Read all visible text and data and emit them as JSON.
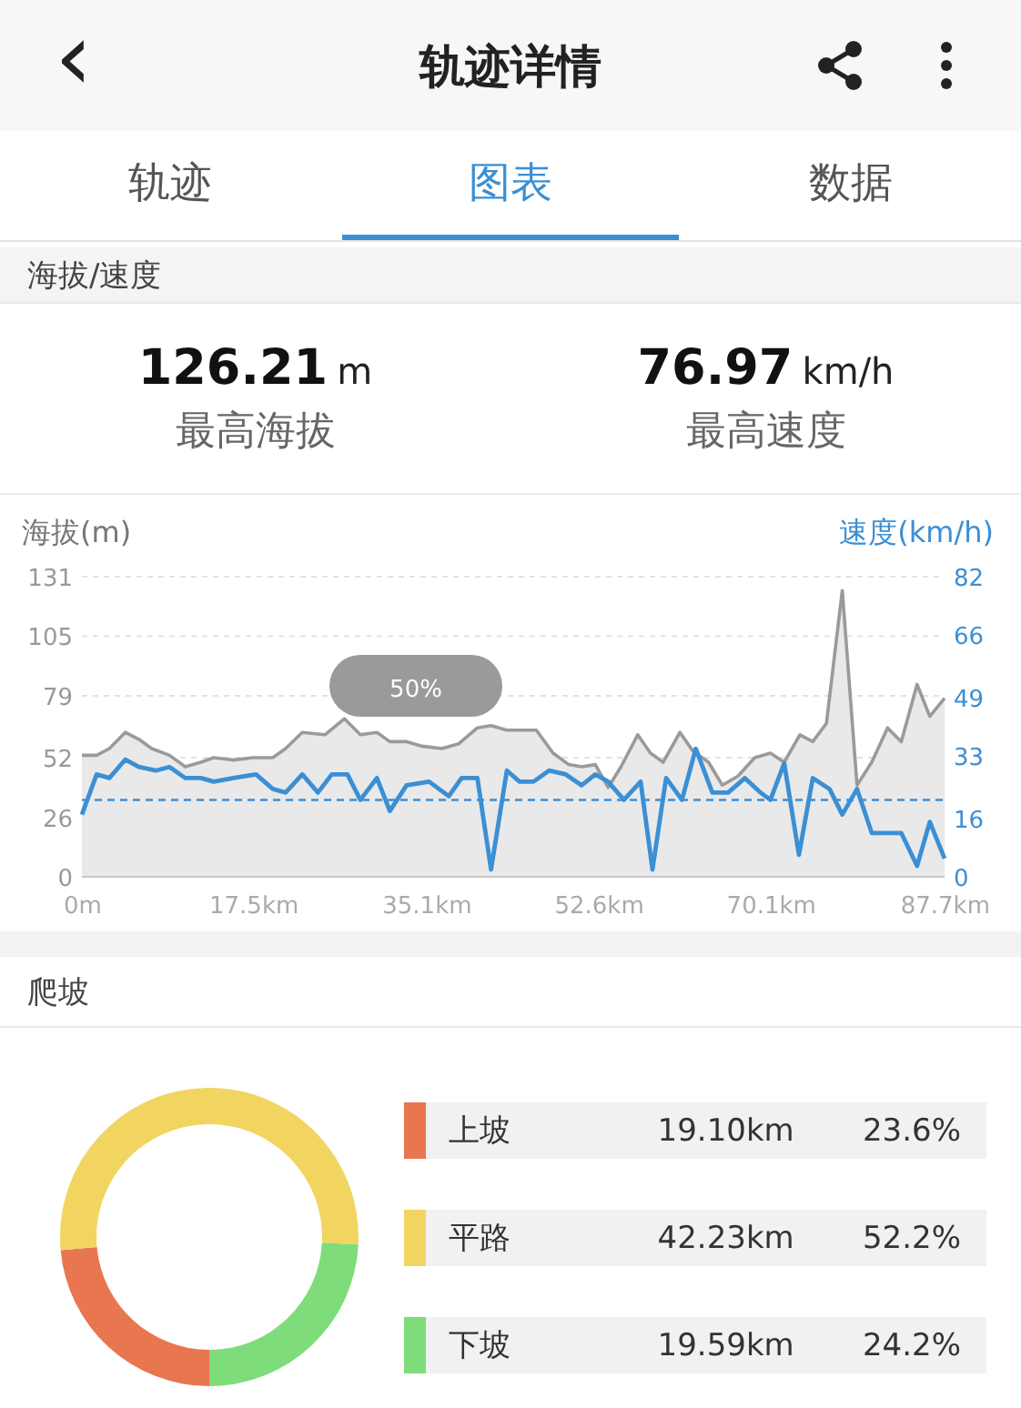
{
  "header": {
    "back": "‹",
    "title": "轨迹详情"
  },
  "tabs": [
    {
      "label": "轨迹",
      "selected": false
    },
    {
      "label": "图表",
      "selected": true
    },
    {
      "label": "数据",
      "selected": false
    }
  ],
  "altitude_speed": {
    "section_title": "海拔/速度",
    "stats": [
      {
        "value": "126.21",
        "unit": "m",
        "label": "最高海拔"
      },
      {
        "value": "76.97",
        "unit": "km/h",
        "label": "最高速度"
      }
    ],
    "zoom_badge": "50%",
    "chart_data": {
      "type": "line",
      "grid": true,
      "xlim": [
        0,
        87.7
      ],
      "ylim": [
        0,
        131
      ],
      "y2lim": [
        0,
        82
      ],
      "y2ticks": [
        0,
        16,
        33,
        49,
        66,
        82
      ],
      "ref_lines": [
        {
          "axis": "y2",
          "value": 21,
          "color": "#3b8fd4"
        }
      ],
      "xticks": [
        {
          "value": 0,
          "label": "0m"
        },
        {
          "value": 17.5,
          "label": "17.5km"
        },
        {
          "value": 35.1,
          "label": "35.1km"
        },
        {
          "value": 52.6,
          "label": "52.6km"
        },
        {
          "value": 70.1,
          "label": "70.1km"
        },
        {
          "value": 87.7,
          "label": "87.7km"
        }
      ],
      "yticks": [
        0,
        26,
        52,
        79,
        105,
        131
      ],
      "series": [
        {
          "name": "海拔(m)",
          "type": "area",
          "color": "#9a9a9a",
          "x": [
            0,
            1.5,
            2.8,
            4.4,
            5.8,
            7.1,
            8.9,
            10.5,
            12.1,
            13.4,
            15.4,
            17.4,
            19.4,
            20.7,
            22.4,
            24.7,
            26.7,
            28.3,
            30.0,
            31.3,
            33.0,
            34.6,
            36.6,
            38.3,
            40.2,
            41.6,
            43.2,
            46.2,
            47.9,
            49.5,
            50.8,
            52.2,
            53.5,
            54.8,
            56.5,
            57.8,
            59.1,
            60.8,
            62.1,
            63.7,
            65.1,
            66.7,
            68.4,
            70.0,
            71.4,
            73.0,
            74.3,
            75.7,
            77.3,
            78.8,
            80.3,
            81.9,
            83.3,
            84.9,
            86.2,
            87.7
          ],
          "values": [
            53,
            53,
            56,
            63,
            60,
            56,
            53,
            48,
            50,
            52,
            51,
            52,
            52,
            56,
            63,
            62,
            69,
            62,
            63,
            59,
            59,
            57,
            56,
            58,
            65,
            66,
            64,
            64,
            54,
            49,
            48,
            49,
            39,
            48,
            62,
            54,
            50,
            63,
            55,
            50,
            40,
            44,
            52,
            54,
            50,
            62,
            59,
            67,
            125,
            40,
            50,
            65,
            59,
            84,
            70,
            78
          ]
        },
        {
          "name": "速度(km/h)",
          "type": "line",
          "color": "#3b8fd4",
          "axis": "y2",
          "x": [
            0,
            1.5,
            2.8,
            4.4,
            5.8,
            7.5,
            8.9,
            10.5,
            12.1,
            13.4,
            15.4,
            17.7,
            19.4,
            20.7,
            22.4,
            24.0,
            25.4,
            27.0,
            28.3,
            30.0,
            31.3,
            33.0,
            35.3,
            37.3,
            38.6,
            40.2,
            41.6,
            43.2,
            44.5,
            45.9,
            47.5,
            49.2,
            50.8,
            52.2,
            53.5,
            55.1,
            56.8,
            58.0,
            59.4,
            61.0,
            62.4,
            64.1,
            65.7,
            67.4,
            69.0,
            70.0,
            71.4,
            72.9,
            74.3,
            76.0,
            77.3,
            78.8,
            80.3,
            81.9,
            83.3,
            84.9,
            86.2,
            87.7
          ],
          "values": [
            17,
            28,
            27,
            32,
            30,
            29,
            30,
            27,
            27,
            26,
            27,
            28,
            24,
            23,
            28,
            23,
            28,
            28,
            21,
            27,
            18,
            25,
            26,
            22,
            27,
            27,
            2,
            29,
            26,
            26,
            29,
            28,
            25,
            28,
            26,
            21,
            26,
            2,
            27,
            21,
            35,
            23,
            23,
            27,
            23,
            21,
            31,
            6,
            27,
            24,
            17,
            24,
            12,
            12,
            12,
            3,
            15,
            5
          ]
        }
      ]
    }
  },
  "climbing": {
    "section_title": "爬坡",
    "chart_data": {
      "type": "donut",
      "categories": [
        "上坡",
        "平路",
        "下坡"
      ],
      "values": [
        23.6,
        52.2,
        24.2
      ],
      "colors": [
        "#e8764f",
        "#f2d561",
        "#7edc7a"
      ]
    },
    "legend": [
      {
        "distance": "19.10km",
        "percent": "23.6%"
      },
      {
        "distance": "42.23km",
        "percent": "52.2%"
      },
      {
        "distance": "19.59km",
        "percent": "24.2%"
      }
    ]
  }
}
